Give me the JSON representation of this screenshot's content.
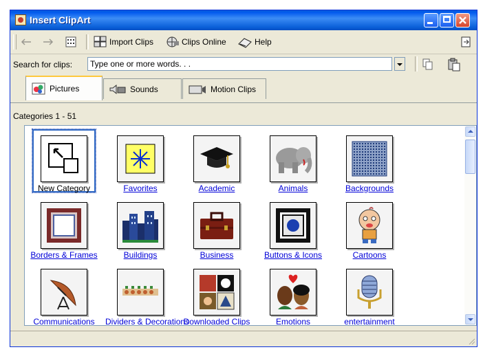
{
  "window": {
    "title": "Insert ClipArt"
  },
  "toolbar": {
    "back_icon": "back-arrow-icon",
    "forward_icon": "forward-arrow-icon",
    "grid_icon": "grid-view-icon",
    "import_label": "Import Clips",
    "online_label": "Clips Online",
    "help_label": "Help"
  },
  "search": {
    "label": "Search for clips:",
    "placeholder": "Type one or more words. . ."
  },
  "tabs": [
    {
      "label": "Pictures",
      "active": true
    },
    {
      "label": "Sounds",
      "active": false
    },
    {
      "label": "Motion Clips",
      "active": false
    }
  ],
  "categories_range": "Categories 1 - 51",
  "categories": [
    {
      "label": "New Category",
      "icon": "new-category-icon"
    },
    {
      "label": "Favorites",
      "icon": "favorites-icon"
    },
    {
      "label": "Academic",
      "icon": "graduation-cap-icon"
    },
    {
      "label": "Animals",
      "icon": "elephant-icon"
    },
    {
      "label": "Backgrounds",
      "icon": "pattern-icon"
    },
    {
      "label": "Borders & Frames",
      "icon": "frame-icon"
    },
    {
      "label": "Buildings",
      "icon": "buildings-icon"
    },
    {
      "label": "Business",
      "icon": "briefcase-icon"
    },
    {
      "label": "Buttons & Icons",
      "icon": "button-icon"
    },
    {
      "label": "Cartoons",
      "icon": "cartoon-icon"
    },
    {
      "label": "Communications",
      "icon": "satellite-dish-icon"
    },
    {
      "label": "Dividers & Decorations",
      "icon": "divider-icon"
    },
    {
      "label": "Downloaded Clips",
      "icon": "downloaded-clips-icon"
    },
    {
      "label": "Emotions",
      "icon": "emotions-icon"
    },
    {
      "label": "entertainment",
      "icon": "microphone-icon"
    }
  ]
}
